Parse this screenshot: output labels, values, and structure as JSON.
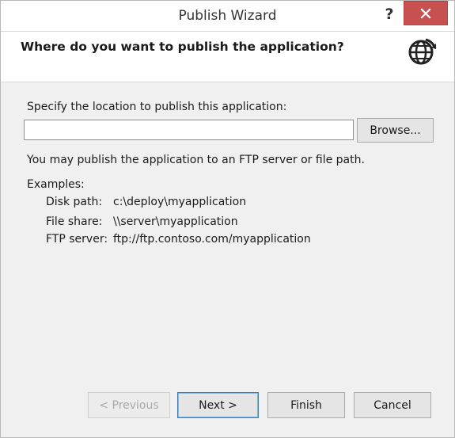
{
  "window": {
    "title": "Publish Wizard",
    "help": "?"
  },
  "header": {
    "title": "Where do you want to publish the application?"
  },
  "icons": {
    "globe": "globe-arrow-icon",
    "close": "close-icon"
  },
  "colors": {
    "close_button": "#c75050",
    "dialog_bg": "#f0f0f0",
    "header_bg": "#ffffff"
  },
  "location": {
    "label": "Specify the location to publish this application:",
    "value": "",
    "browse_label": "Browse..."
  },
  "hint": "You may publish the application to an FTP server or file path.",
  "examples": {
    "heading": "Examples:",
    "items": [
      {
        "name": "Disk path:",
        "value": "c:\\deploy\\myapplication"
      },
      {
        "name": "File share:",
        "value": "\\\\server\\myapplication"
      },
      {
        "name": "FTP server:",
        "value": "ftp://ftp.contoso.com/myapplication"
      }
    ]
  },
  "buttons": {
    "previous": "< Previous",
    "next": "Next >",
    "finish": "Finish",
    "cancel": "Cancel"
  }
}
